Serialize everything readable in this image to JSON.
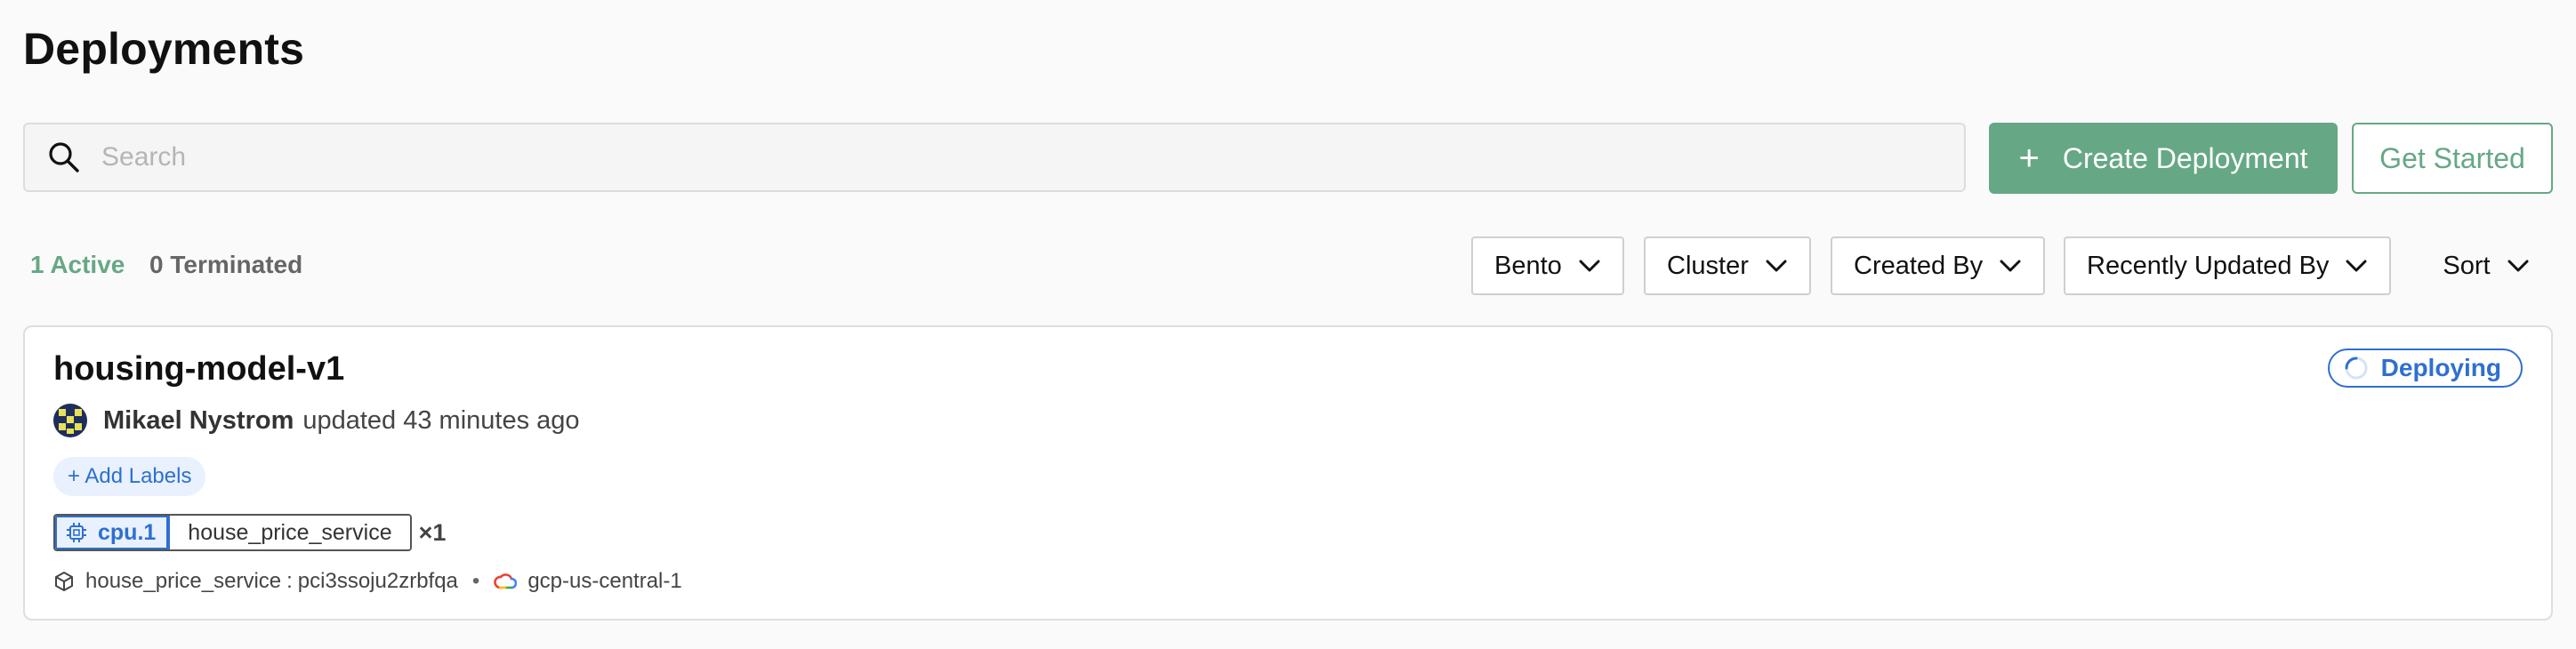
{
  "page": {
    "title": "Deployments"
  },
  "search": {
    "placeholder": "Search",
    "value": ""
  },
  "actions": {
    "create_plus": "+",
    "create_label": "Create Deployment",
    "get_started_label": "Get Started"
  },
  "tabs": [
    {
      "label": "1 Active",
      "active": true
    },
    {
      "label": "0 Terminated",
      "active": false
    }
  ],
  "filters": [
    {
      "label": "Bento"
    },
    {
      "label": "Cluster"
    },
    {
      "label": "Created By"
    },
    {
      "label": "Recently Updated By"
    }
  ],
  "sort": {
    "label": "Sort"
  },
  "deployment": {
    "name": "housing-model-v1",
    "status": "Deploying",
    "user": "Mikael Nystrom",
    "updated_text": "updated 43 minutes ago",
    "add_labels": "+ Add Labels",
    "instance_type": "cpu.1",
    "service": "house_price_service",
    "replicas": "×1",
    "bento_name": "house_price_service",
    "bento_sep": ":",
    "bento_version": "pci3ssoju2zrbfqa",
    "dot": "•",
    "cluster": "gcp-us-central-1"
  },
  "colors": {
    "accent_green": "#66a885",
    "accent_blue": "#2f6fd1",
    "background": "#fafafa"
  },
  "icons": {
    "search": "search-icon",
    "chevron": "chevron-down-icon",
    "spinner": "spinner-icon",
    "cpu": "cpu-chip-icon",
    "bento": "package-box-icon",
    "cloud": "google-cloud-icon"
  }
}
